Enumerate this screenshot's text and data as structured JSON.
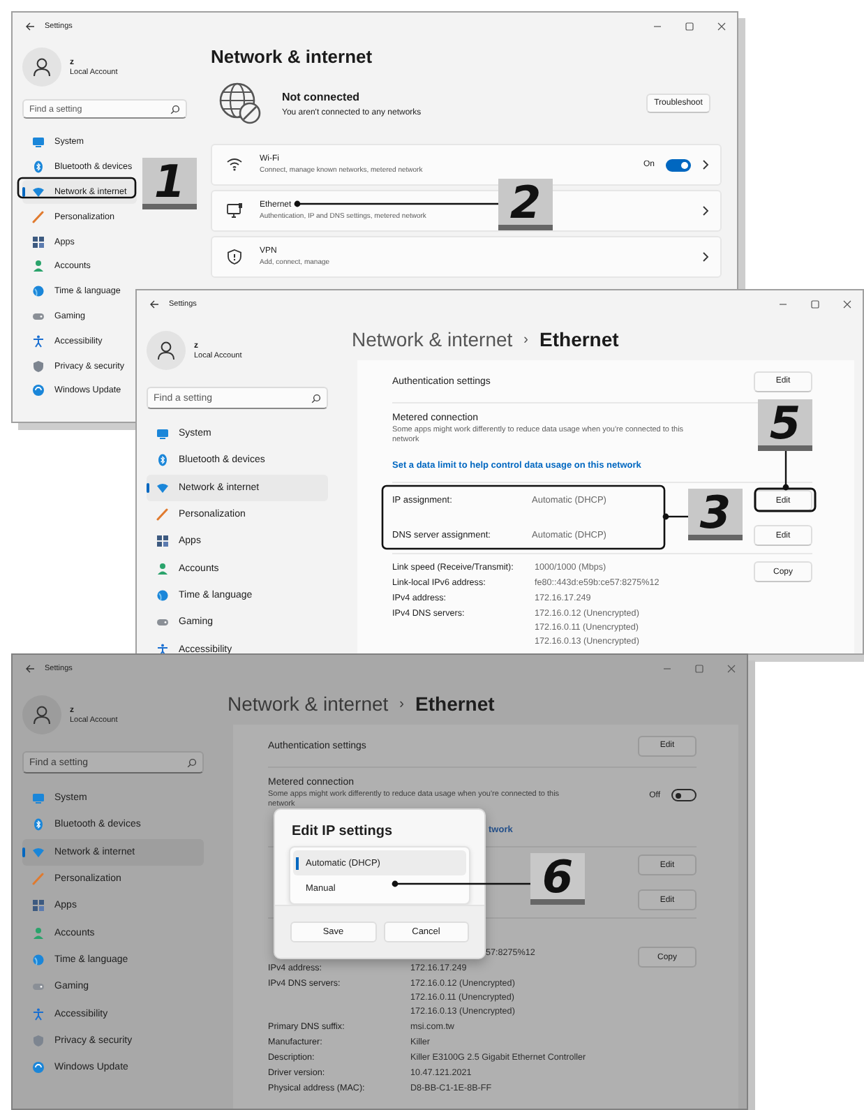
{
  "windows": [
    {
      "kind": "overview",
      "dimmed": false,
      "title": "Settings",
      "account": {
        "name": "z",
        "type": "Local Account"
      },
      "search": {
        "placeholder": "Find a setting"
      },
      "nav": [
        {
          "label": "System",
          "selected": false
        },
        {
          "label": "Bluetooth & devices",
          "selected": false
        },
        {
          "label": "Network & internet",
          "selected": true
        },
        {
          "label": "Personalization",
          "selected": false
        },
        {
          "label": "Apps",
          "selected": false
        },
        {
          "label": "Accounts",
          "selected": false
        },
        {
          "label": "Time & language",
          "selected": false
        },
        {
          "label": "Gaming",
          "selected": false
        },
        {
          "label": "Accessibility",
          "selected": false
        },
        {
          "label": "Privacy & security",
          "selected": false
        },
        {
          "label": "Windows Update",
          "selected": false
        }
      ],
      "heading": "Network & internet",
      "status": {
        "title": "Not connected",
        "subtitle": "You aren't connected to any networks",
        "button": "Troubleshoot"
      },
      "cards": [
        {
          "title": "Wi-Fi",
          "subtitle": "Connect, manage known networks, metered network",
          "toggle_label": "On",
          "on": true
        },
        {
          "title": "Ethernet",
          "subtitle": "Authentication, IP and DNS settings, metered network"
        },
        {
          "title": "VPN",
          "subtitle": "Add, connect, manage"
        }
      ]
    },
    {
      "kind": "ethernet",
      "dimmed": false,
      "title": "Settings",
      "account": {
        "name": "z",
        "type": "Local Account"
      },
      "search": {
        "placeholder": "Find a setting"
      },
      "nav": [
        {
          "label": "System",
          "selected": false
        },
        {
          "label": "Bluetooth & devices",
          "selected": false
        },
        {
          "label": "Network & internet",
          "selected": true
        },
        {
          "label": "Personalization",
          "selected": false
        },
        {
          "label": "Apps",
          "selected": false
        },
        {
          "label": "Accounts",
          "selected": false
        },
        {
          "label": "Time & language",
          "selected": false
        },
        {
          "label": "Gaming",
          "selected": false
        },
        {
          "label": "Accessibility",
          "selected": false
        }
      ],
      "breadcrumb": {
        "parent": "Network & internet",
        "separator": "›",
        "current": "Ethernet"
      },
      "authentication": {
        "label": "Authentication settings",
        "button": "Edit"
      },
      "metered": {
        "title": "Metered connection",
        "description": "Some apps might work differently to reduce data usage when you're connected to this network",
        "link": "Set a data limit to help control data usage on this network"
      },
      "assignments": [
        {
          "label": "IP assignment:",
          "value": "Automatic (DHCP)",
          "button": "Edit"
        },
        {
          "label": "DNS server assignment:",
          "value": "Automatic (DHCP)",
          "button": "Edit"
        }
      ],
      "copy_button": "Copy",
      "details": [
        {
          "label": "Link speed (Receive/Transmit):",
          "values": [
            "1000/1000 (Mbps)"
          ]
        },
        {
          "label": "Link-local IPv6 address:",
          "values": [
            "fe80::443d:e59b:ce57:8275%12"
          ]
        },
        {
          "label": "IPv4 address:",
          "values": [
            "172.16.17.249"
          ]
        },
        {
          "label": "IPv4 DNS servers:",
          "values": [
            "172.16.0.12 (Unencrypted)",
            "172.16.0.11 (Unencrypted)",
            "172.16.0.13 (Unencrypted)"
          ]
        }
      ]
    },
    {
      "kind": "ethernet",
      "dimmed": true,
      "title": "Settings",
      "account": {
        "name": "z",
        "type": "Local Account"
      },
      "search": {
        "placeholder": "Find a setting"
      },
      "nav": [
        {
          "label": "System",
          "selected": false
        },
        {
          "label": "Bluetooth & devices",
          "selected": false
        },
        {
          "label": "Network & internet",
          "selected": true
        },
        {
          "label": "Personalization",
          "selected": false
        },
        {
          "label": "Apps",
          "selected": false
        },
        {
          "label": "Accounts",
          "selected": false
        },
        {
          "label": "Time & language",
          "selected": false
        },
        {
          "label": "Gaming",
          "selected": false
        },
        {
          "label": "Accessibility",
          "selected": false
        },
        {
          "label": "Privacy & security",
          "selected": false
        },
        {
          "label": "Windows Update",
          "selected": false
        }
      ],
      "breadcrumb": {
        "parent": "Network & internet",
        "separator": "›",
        "current": "Ethernet"
      },
      "authentication": {
        "label": "Authentication settings",
        "button": "Edit"
      },
      "metered": {
        "title": "Metered connection",
        "description": "Some apps might work differently to reduce data usage when you're connected to this network",
        "toggle_label": "Off",
        "on": false,
        "link_fragment": "twork"
      },
      "assignments": [
        {
          "button": "Edit"
        },
        {
          "button": "Edit"
        }
      ],
      "copy_button": "Copy",
      "details": [
        {
          "values": [
            "57:8275%12"
          ]
        },
        {
          "label": "IPv4 address:",
          "values": [
            "172.16.17.249"
          ]
        },
        {
          "label": "IPv4 DNS servers:",
          "values": [
            "172.16.0.12 (Unencrypted)",
            "172.16.0.11 (Unencrypted)",
            "172.16.0.13 (Unencrypted)"
          ]
        },
        {
          "label": "Primary DNS suffix:",
          "values": [
            "msi.com.tw"
          ]
        },
        {
          "label": "Manufacturer:",
          "values": [
            "Killer"
          ]
        },
        {
          "label": "Description:",
          "values": [
            "Killer E3100G 2.5 Gigabit Ethernet Controller"
          ]
        },
        {
          "label": "Driver version:",
          "values": [
            "10.47.121.2021"
          ]
        },
        {
          "label": "Physical address (MAC):",
          "values": [
            "D8-BB-C1-1E-8B-FF"
          ]
        }
      ],
      "dialog": {
        "title": "Edit IP settings",
        "options": [
          {
            "label": "Automatic (DHCP)",
            "selected": true
          },
          {
            "label": "Manual",
            "selected": false
          }
        ],
        "buttons": [
          "Save",
          "Cancel"
        ]
      }
    }
  ],
  "callouts": [
    {
      "number": "1"
    },
    {
      "number": "2"
    },
    {
      "number": "3"
    },
    {
      "number": "5"
    },
    {
      "number": "6"
    }
  ]
}
